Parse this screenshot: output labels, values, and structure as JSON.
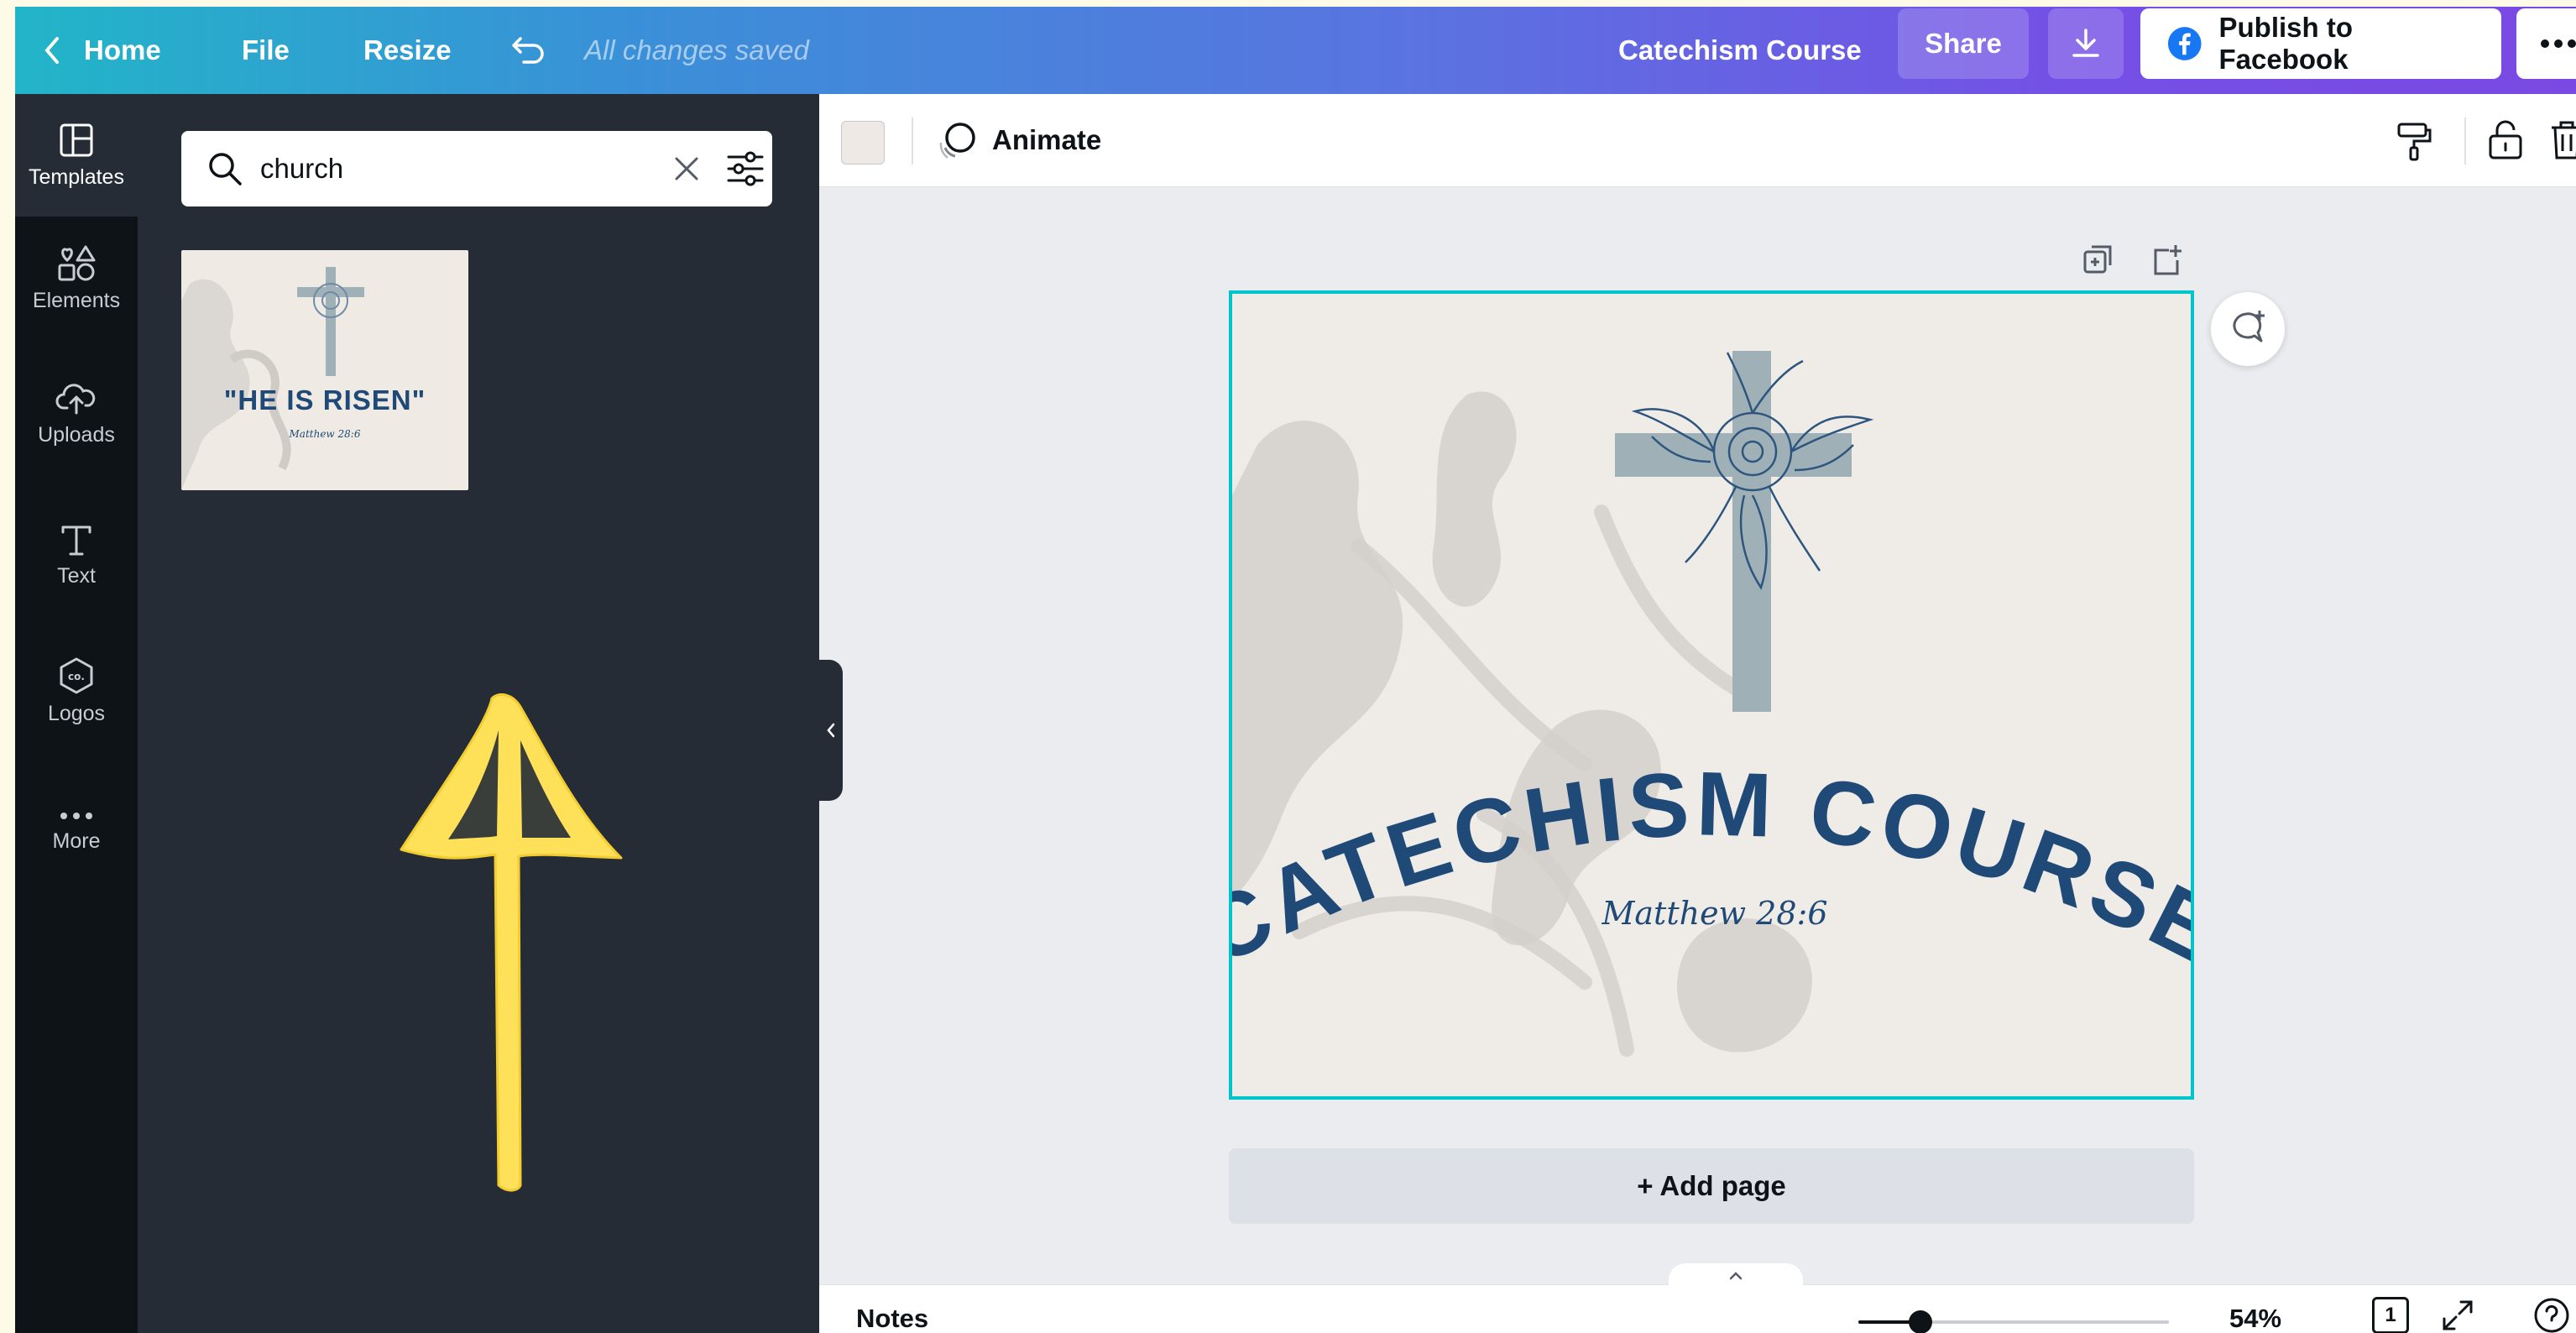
{
  "topbar": {
    "home_label": "Home",
    "file_label": "File",
    "resize_label": "Resize",
    "saved_status": "All changes saved",
    "design_title": "Catechism Course",
    "share_label": "Share",
    "publish_label": "Publish to Facebook",
    "icons": [
      "chevron-left-icon",
      "undo-icon",
      "download-icon",
      "facebook-icon",
      "more-horizontal-icon"
    ]
  },
  "sidebar": {
    "items": [
      {
        "label": "Templates",
        "icon": "templates-icon",
        "active": true
      },
      {
        "label": "Elements",
        "icon": "elements-icon"
      },
      {
        "label": "Uploads",
        "icon": "upload-cloud-icon"
      },
      {
        "label": "Text",
        "icon": "text-icon"
      },
      {
        "label": "Logos",
        "icon": "logo-badge-icon"
      },
      {
        "label": "More",
        "icon": "dots-icon"
      }
    ]
  },
  "panel": {
    "search_value": "church",
    "template_result": {
      "title": "\"HE IS RISEN\"",
      "subtitle": "Matthew 28:6"
    }
  },
  "editor_toolbar": {
    "animate_label": "Animate",
    "swatch_color": "#efe9e6"
  },
  "canvas": {
    "headline": "CATECHISM COURSE",
    "verse": "Matthew 28:6",
    "background_color": "#efebe7",
    "text_color": "#1f4a78",
    "cross_color": "#9fb1b6",
    "selection_color": "#00c4cc"
  },
  "add_page_label": "+ Add page",
  "footer": {
    "notes_label": "Notes",
    "zoom_label": "54%",
    "zoom_fraction": 0.2,
    "page_number": "1"
  },
  "overlay": {
    "arrow_color": "#ffe059"
  }
}
